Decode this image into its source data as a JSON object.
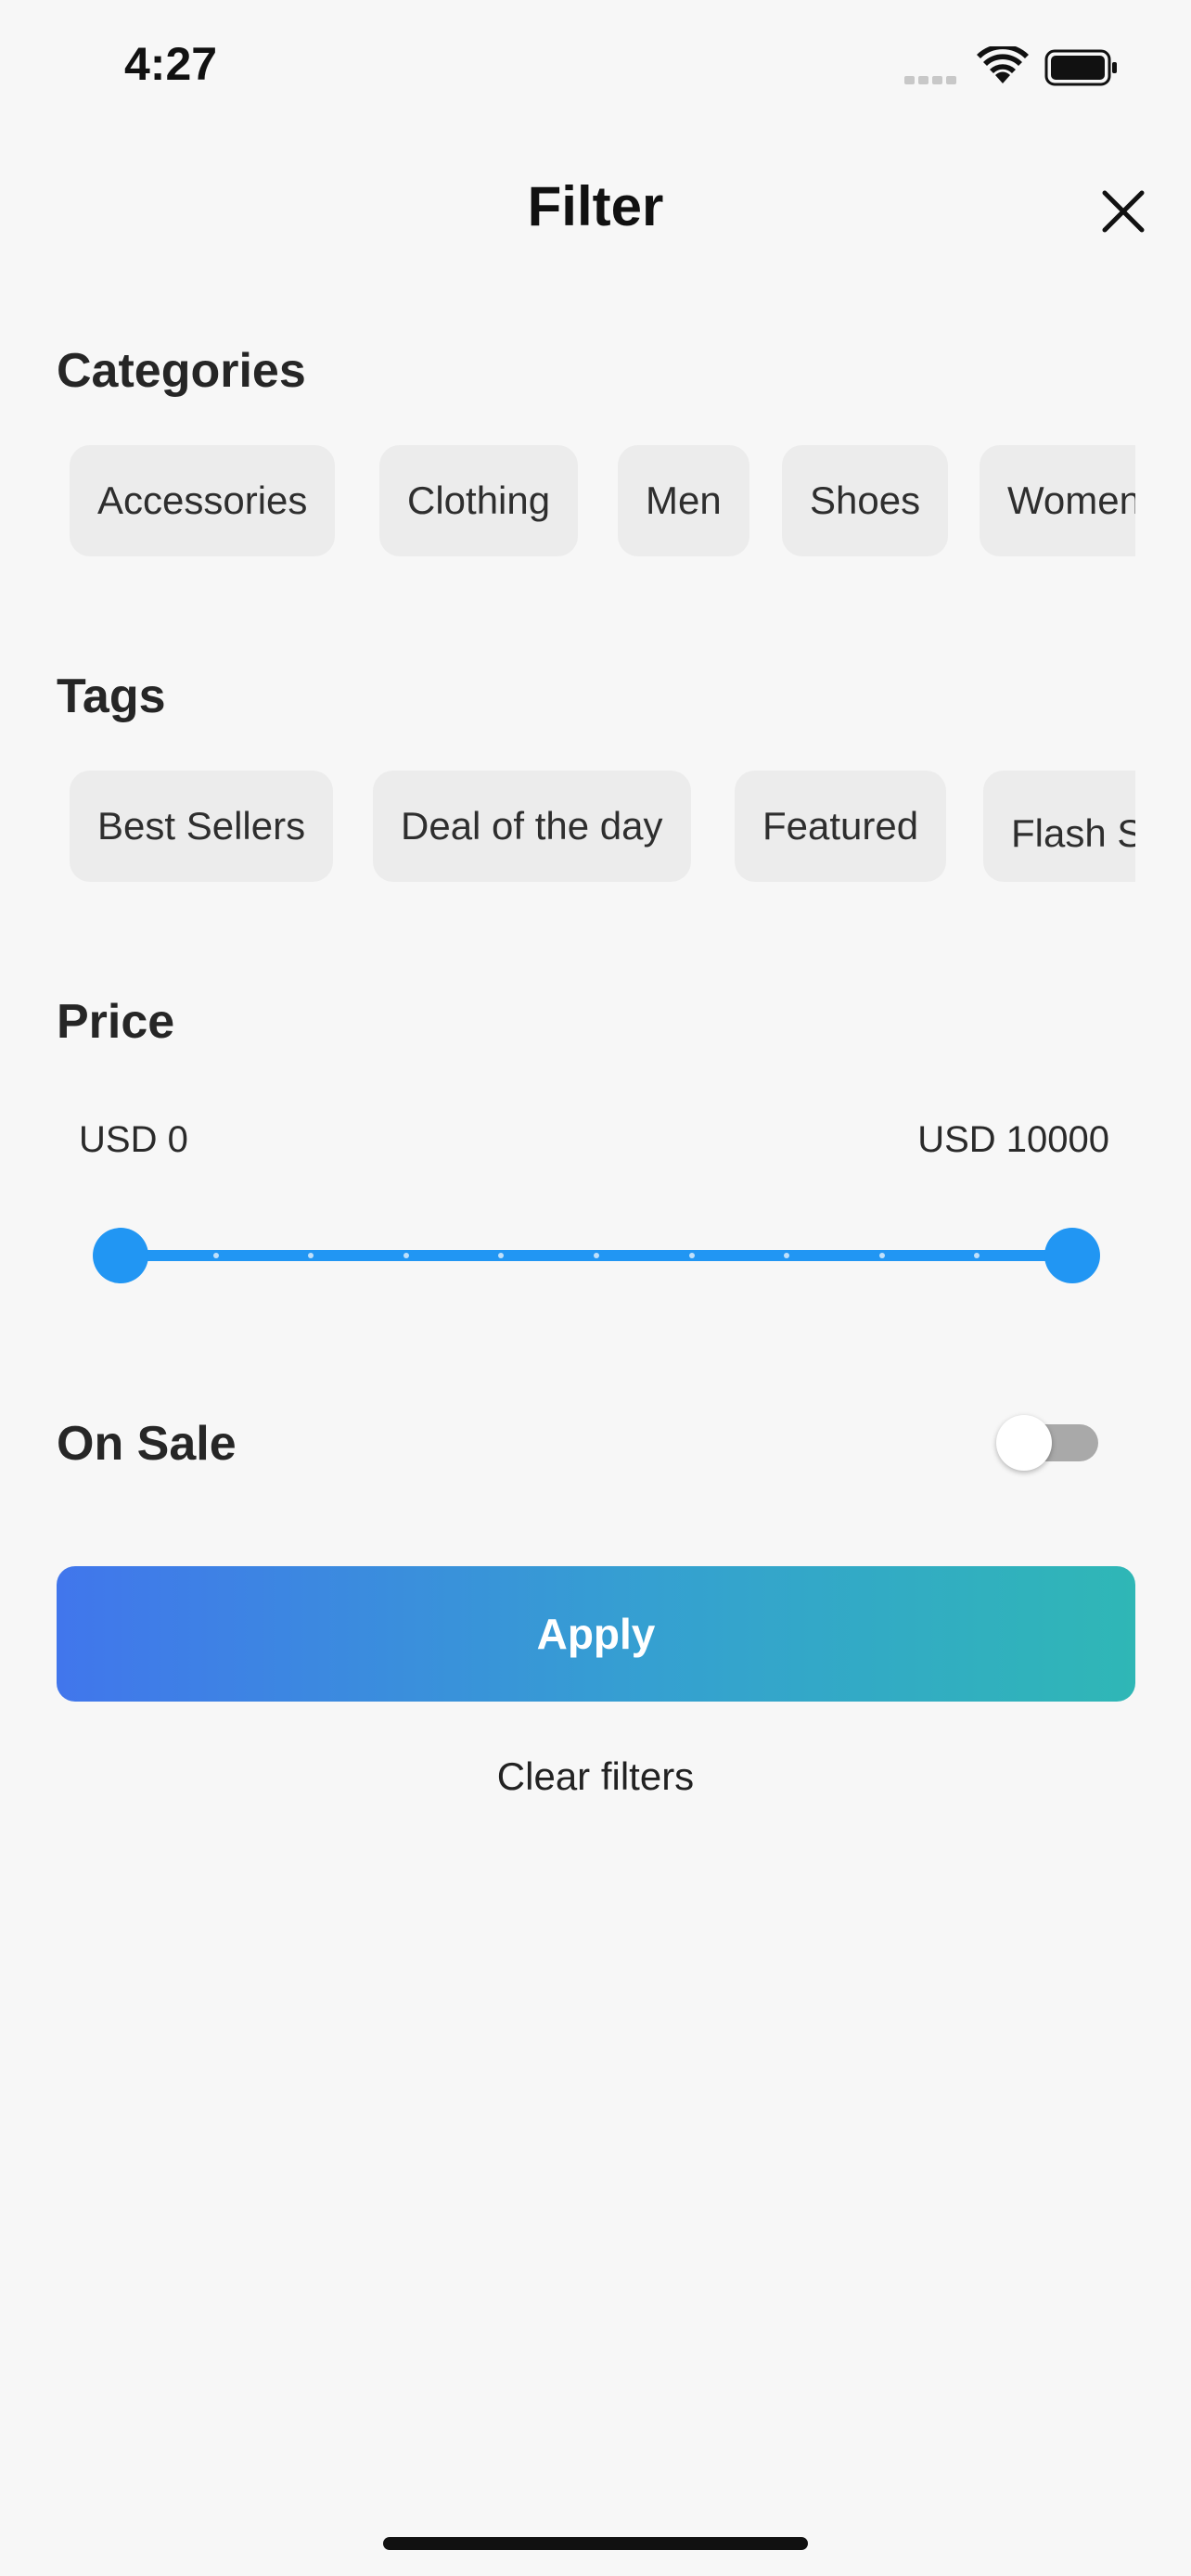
{
  "status_bar": {
    "time": "4:27"
  },
  "header": {
    "title": "Filter"
  },
  "categories": {
    "title": "Categories",
    "chips": [
      "Accessories",
      "Clothing",
      "Men",
      "Shoes",
      "Women"
    ]
  },
  "tags": {
    "title": "Tags",
    "chips": [
      "Best Sellers",
      "Deal of the day",
      "Featured",
      "Flash Sale"
    ]
  },
  "price": {
    "title": "Price",
    "min_label": "USD 0",
    "max_label": "USD 10000",
    "range_min": 0,
    "range_max": 10000,
    "selected_min": 0,
    "selected_max": 10000,
    "divisions": 10,
    "accent_color": "#2196f3"
  },
  "on_sale": {
    "label": "On Sale",
    "enabled": false
  },
  "actions": {
    "apply_label": "Apply",
    "clear_label": "Clear filters"
  }
}
